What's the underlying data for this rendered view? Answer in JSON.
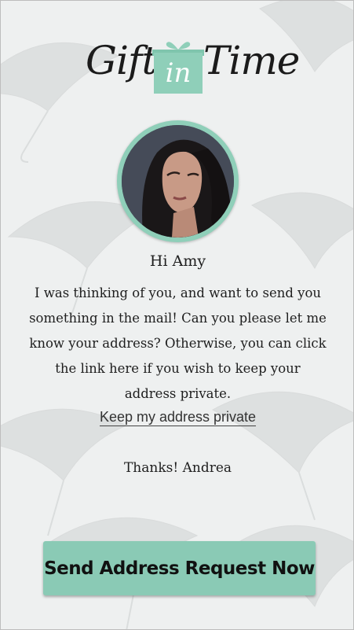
{
  "colors": {
    "accent": "#8acab5",
    "background": "#eef0f0",
    "text": "#1e1e1e"
  },
  "logo": {
    "word_left": "Gift",
    "word_box": "in",
    "word_right": "Time",
    "icon": "gift-box-icon"
  },
  "profile": {
    "avatar": "woman-portrait-avatar"
  },
  "greeting": "Hi Amy",
  "message_lines": [
    "I was thinking of you, and want to send you",
    "something in the mail! Can you please let me",
    "know your address? Otherwise, you can click",
    "the link here  if you wish to keep your",
    "address private."
  ],
  "private_link_label": "Keep my address private",
  "signoff": "Thanks! Andrea",
  "cta_label": "Send Address Request Now"
}
